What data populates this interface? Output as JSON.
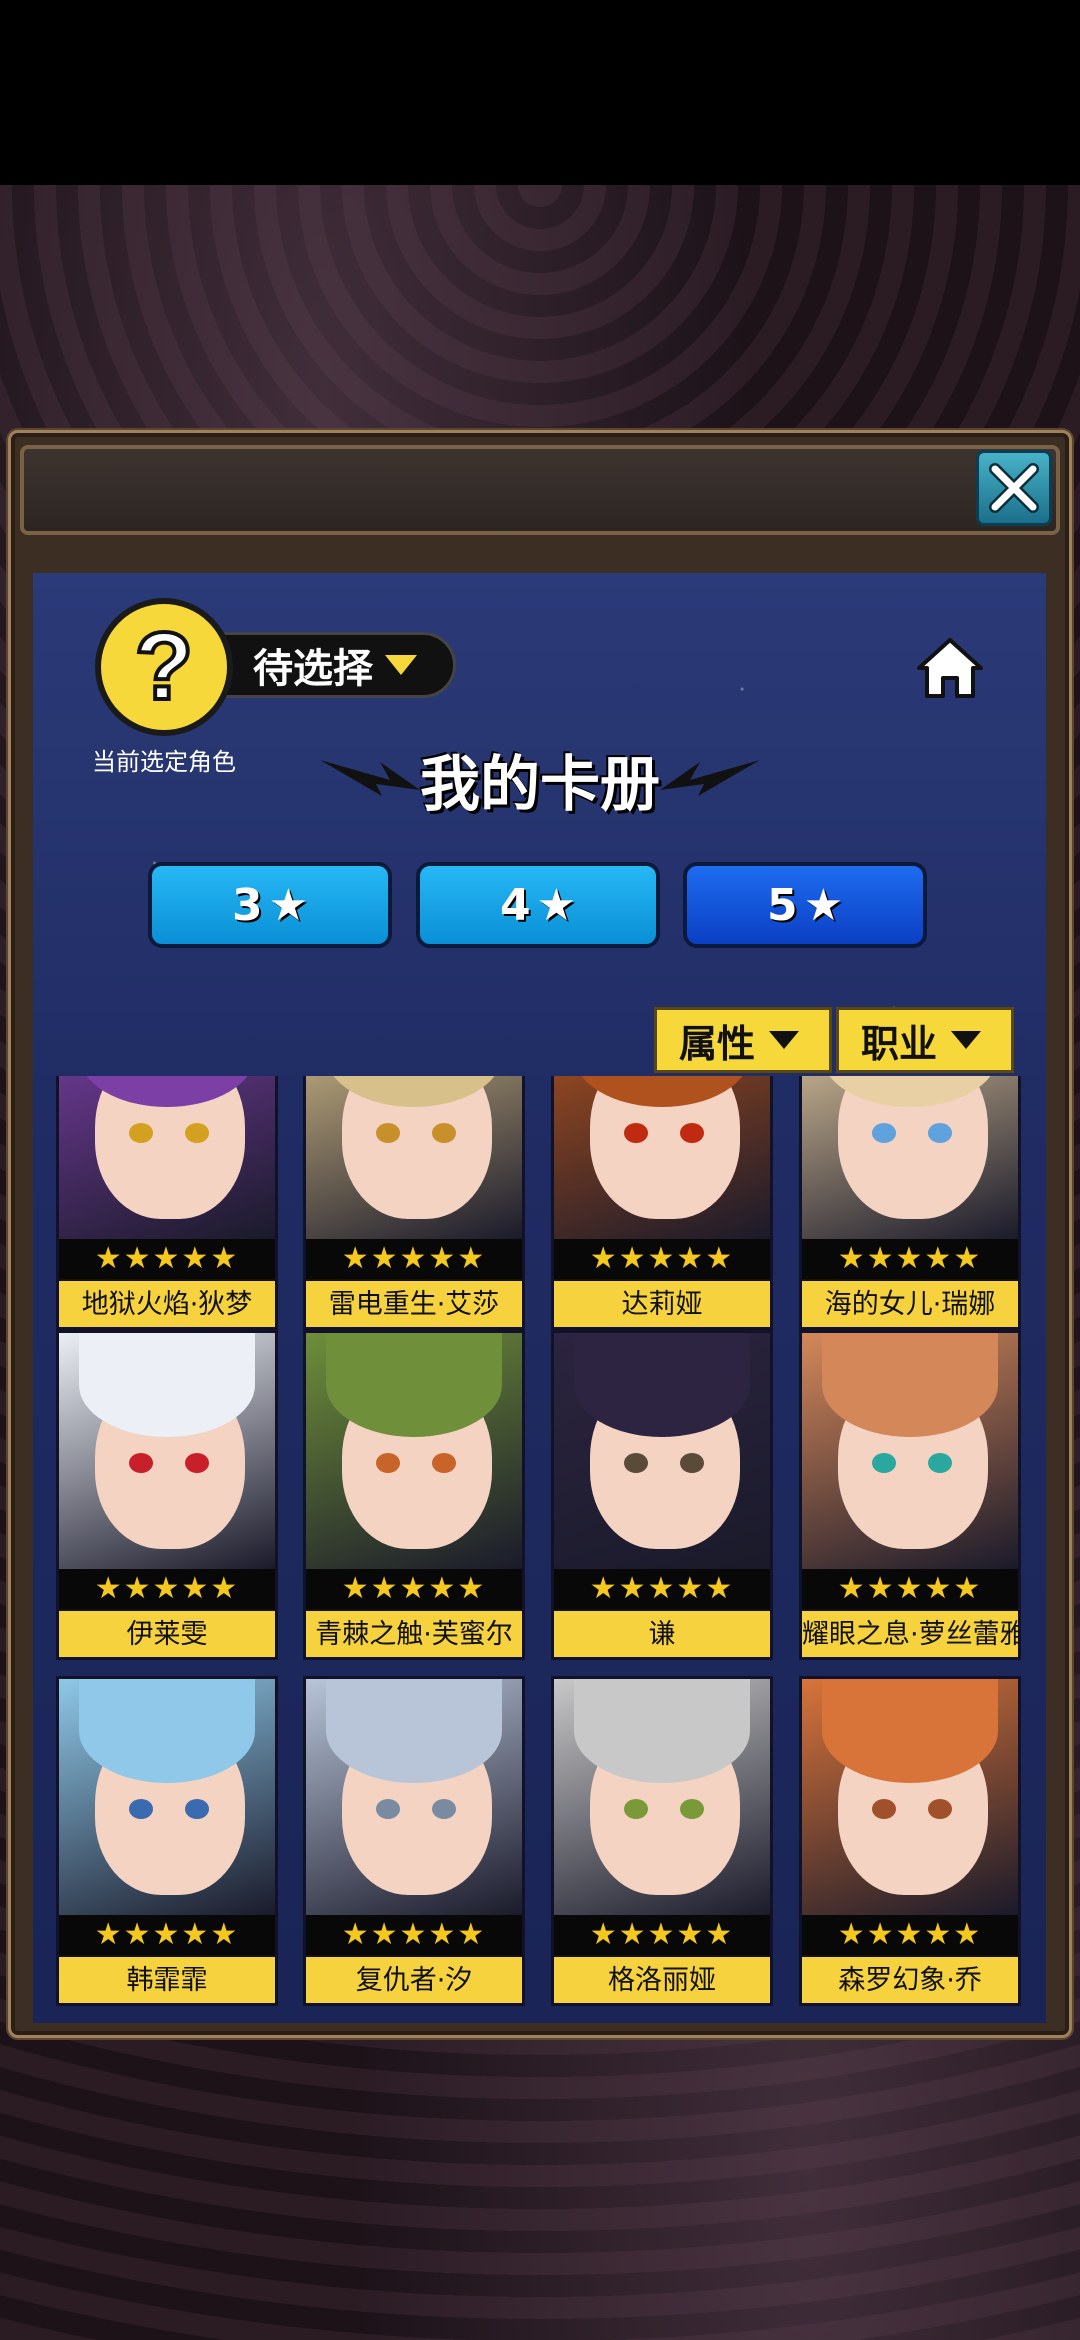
{
  "header": {
    "current_selection_label": "待选择",
    "current_selection_caption": "当前选定角色",
    "avatar_glyph": "?",
    "page_title": "我的卡册"
  },
  "star_filters": [
    {
      "label": "3",
      "glyph": "★",
      "active": false
    },
    {
      "label": "4",
      "glyph": "★",
      "active": false
    },
    {
      "label": "5",
      "glyph": "★",
      "active": true
    }
  ],
  "dropdown_filters": {
    "attribute_label": "属性",
    "class_label": "职业"
  },
  "cards": [
    {
      "name": "地狱火焰·狄梦",
      "stars": "★★★★★",
      "hair": "#7b3fa5",
      "eye": "#d4a020"
    },
    {
      "name": "雷电重生·艾莎",
      "stars": "★★★★★",
      "hair": "#d8c08a",
      "eye": "#c8902a"
    },
    {
      "name": "达莉娅",
      "stars": "★★★★★",
      "hair": "#b0521e",
      "eye": "#c02a10"
    },
    {
      "name": "海的女儿·瑞娜",
      "stars": "★★★★★",
      "hair": "#e8cfa4",
      "eye": "#5fa2dd"
    },
    {
      "name": "伊莱雯",
      "stars": "★★★★★",
      "hair": "#eceff5",
      "eye": "#c8202a"
    },
    {
      "name": "青棘之触·芙蜜尔",
      "stars": "★★★★★",
      "hair": "#6f8f3a",
      "eye": "#c8642a"
    },
    {
      "name": "谦",
      "stars": "★★★★★",
      "hair": "#2c2440",
      "eye": "#5a4a3a"
    },
    {
      "name": "耀眼之息·萝丝蕾雅",
      "stars": "★★★★★",
      "hair": "#d4885a",
      "eye": "#2aa8a0"
    },
    {
      "name": "韩霏霏",
      "stars": "★★★★★",
      "hair": "#8fc8e8",
      "eye": "#3a6ab0"
    },
    {
      "name": "复仇者·汐",
      "stars": "★★★★★",
      "hair": "#b8c4d8",
      "eye": "#7a8aa0"
    },
    {
      "name": "格洛丽娅",
      "stars": "★★★★★",
      "hair": "#c8c8c8",
      "eye": "#7a9a3a"
    },
    {
      "name": "森罗幻象·乔",
      "stars": "★★★★★",
      "hair": "#d8743a",
      "eye": "#a0502a"
    }
  ],
  "colors": {
    "panel_blue": "#1f2b62",
    "tab_light": "#0a8fd6",
    "tab_active": "#0b3fc4",
    "accent_yellow": "#f7d83a",
    "star_gold": "#f5c820",
    "close_teal": "#1b6f8a"
  },
  "icons": [
    "close-icon",
    "home-icon",
    "question-icon",
    "star-icon",
    "dropdown-arrow-icon"
  ]
}
